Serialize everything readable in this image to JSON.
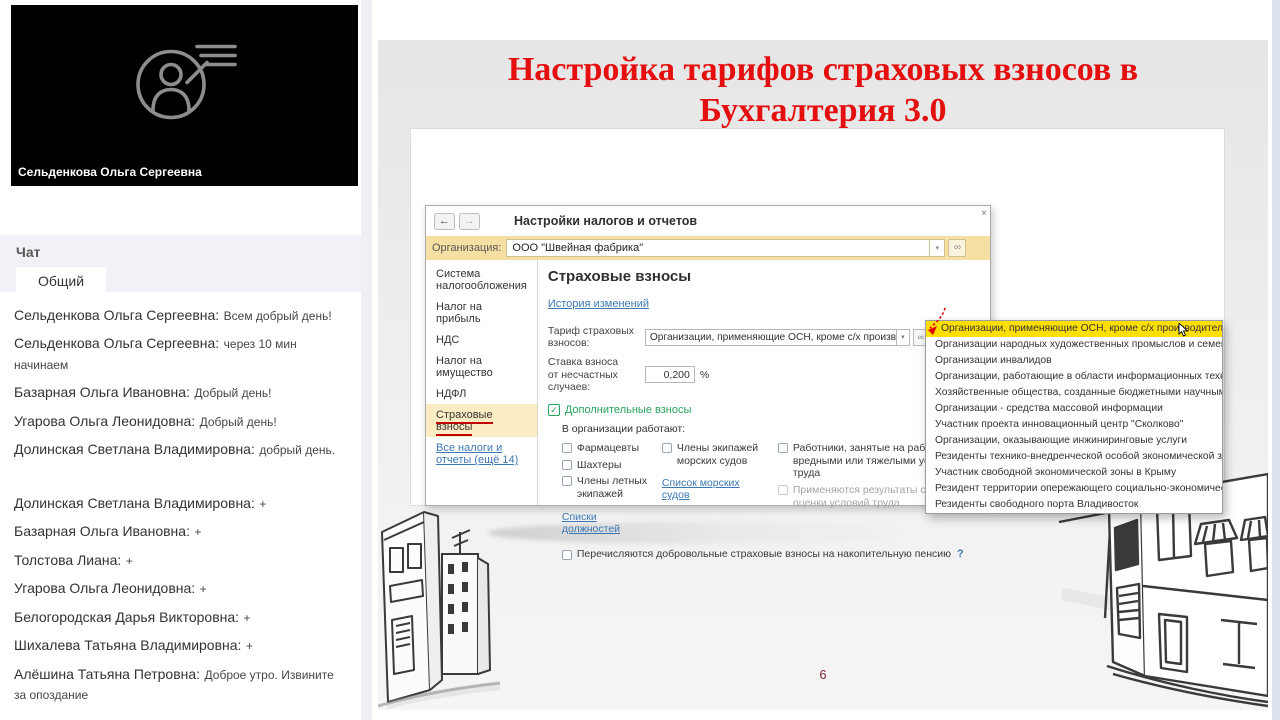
{
  "video_panel": {
    "speaker_name": "Сельденкова Ольга Сергеевна"
  },
  "chat": {
    "title": "Чат",
    "tab": "Общий",
    "messages": [
      {
        "author": "Сельденкова Ольга Сергеевна",
        "text": "Всем добрый день!"
      },
      {
        "author": "Сельденкова Ольга Сергеевна",
        "text": "через 10 мин начинаем"
      },
      {
        "author": "Базарная Ольга Ивановна",
        "text": "Добрый день!"
      },
      {
        "author": "Угарова Ольга Леонидовна",
        "text": "Добрый день!"
      },
      {
        "author": "Долинская Светлана Владимировна",
        "text": "добрый день."
      },
      {
        "author": "Долинская Светлана Владимировна",
        "text": "+"
      },
      {
        "author": "Базарная Ольга Ивановна",
        "text": "+"
      },
      {
        "author": "Толстова Лиана",
        "text": "+"
      },
      {
        "author": "Угарова Ольга Леонидовна",
        "text": "+"
      },
      {
        "author": "Белогородская Дарья  Викторовна",
        "text": "+"
      },
      {
        "author": "Шихалева Татьяна Владимировна",
        "text": "+"
      },
      {
        "author": "Алёшина Татьяна Петровна",
        "text": "Доброе утро. Извините за опоздание"
      }
    ]
  },
  "slide": {
    "title_line1": "Настройка тарифов страховых взносов в",
    "title_line2": "Бухгалтерия 3.0",
    "page_number": "6"
  },
  "app": {
    "window_title": "Настройки налогов и отчетов",
    "org_label": "Организация:",
    "org_value": "ООО \"Швейная фабрика\"",
    "nav": [
      "Система налогообложения",
      "Налог на прибыль",
      "НДС",
      "Налог на имущество",
      "НДФЛ",
      "Страховые взносы"
    ],
    "nav_more_link": "Все налоги и отчеты (ещё 14)",
    "form": {
      "section_title": "Страховые взносы",
      "history_link": "История изменений",
      "tariff_label": "Тариф страховых взносов:",
      "tariff_value": "Организации, применяющие ОСН, кроме с/х производителей",
      "rate_label_line1": "Ставка взноса",
      "rate_label_line2": "от несчастных случаев:",
      "rate_value": "0,200",
      "rate_unit": "%",
      "additional_group": "Дополнительные взносы",
      "works_label": "В организации работают:",
      "col1_items": [
        "Фармацевты",
        "Шахтеры",
        "Члены летных экипажей"
      ],
      "col1_link": "Списки должностей",
      "col2_item": "Члены экипажей морских судов",
      "col2_link": "Список морских судов",
      "col3_item1": "Работники, занятые на работах с вредными или тяжелыми условиями труда",
      "col3_item2": "Применяются результаты специальной оценки условий труда",
      "bottom_checkbox": "Перечисляются добровольные страховые взносы на накопительную пенсию",
      "help_mark": "?"
    },
    "dropdown": {
      "items": [
        "Организации, применяющие ОСН, кроме с/х производителей",
        "Организации народных художественных промыслов и семейных (родовых) общин",
        "Организации инвалидов",
        "Организации, работающие в области информационных технологий",
        "Хозяйственные общества, созданные бюджетными научными учреждениями и ВУЗами",
        "Организации - средства массовой информации",
        "Участник проекта инновационный центр \"Сколково\"",
        "Организации, оказывающие инжиниринговые услуги",
        "Резиденты технико-внедренческой особой экономической зоны",
        "Участник свободной экономической зоны в Крыму",
        "Резидент территории опережающего социально-экономического развития",
        "Резиденты свободного порта Владивосток"
      ]
    }
  },
  "icons": {
    "back": "←",
    "forward": "→",
    "close": "×",
    "dropdown": "▾",
    "link": "∞",
    "check": "✓"
  },
  "colors": {
    "title_red": "#e60f0f",
    "org_bar_yellow": "#f6dfa2",
    "selected_yellow": "#ffdf00",
    "nav_active_yellow": "#fcecc3",
    "link_blue": "#3c78b4",
    "group_green": "#27a35b",
    "page_number_maroon": "#7e2a3c"
  }
}
